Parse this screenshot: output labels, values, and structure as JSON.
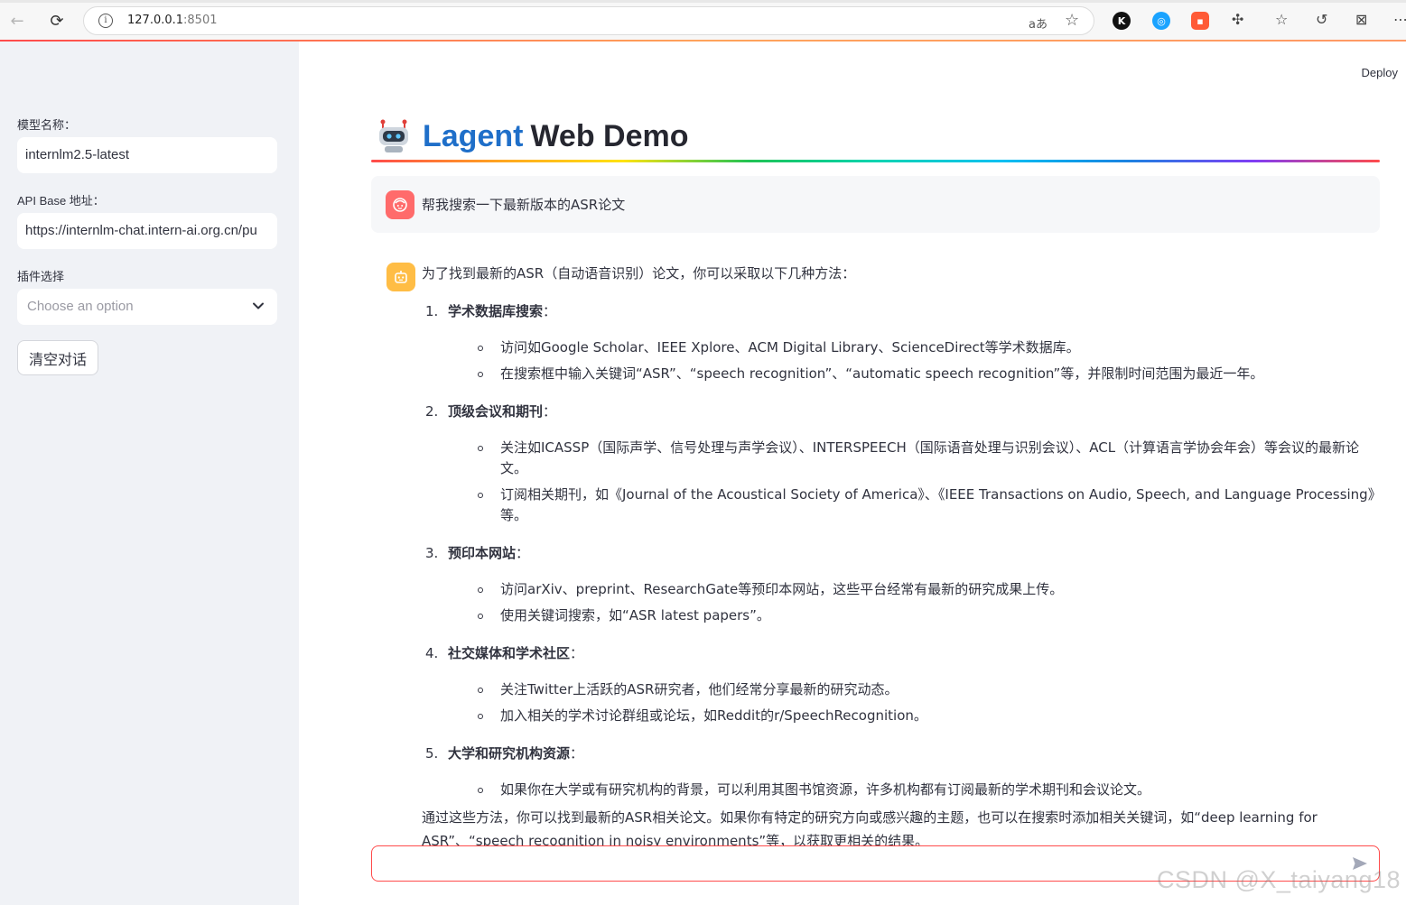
{
  "browser": {
    "url_host": "127.0.0.1",
    "url_port": ":8501"
  },
  "sidebar": {
    "model_label": "模型名称：",
    "model_value": "internlm2.5-latest",
    "api_label": "API Base 地址：",
    "api_value": "https://internlm-chat.intern-ai.org.cn/pu",
    "plugin_label": "插件选择",
    "plugin_placeholder": "Choose an option",
    "clear_button": "清空对话"
  },
  "header": {
    "deploy": "Deploy",
    "title_blue": "Lagent",
    "title_dark": "Web Demo"
  },
  "chat": {
    "user_message": "帮我搜索一下最新版本的ASR论文",
    "assistant": {
      "intro": "为了找到最新的ASR（自动语音识别）论文，你可以采取以下几种方法：",
      "items": [
        {
          "num": "1.",
          "title": "学术数据库搜索",
          "colon": "：",
          "bullets": [
            "访问如Google Scholar、IEEE Xplore、ACM Digital Library、ScienceDirect等学术数据库。",
            "在搜索框中输入关键词“ASR”、“speech recognition”、“automatic speech recognition”等，并限制时间范围为最近一年。"
          ]
        },
        {
          "num": "2.",
          "title": "顶级会议和期刊",
          "colon": "：",
          "bullets": [
            "关注如ICASSP（国际声学、信号处理与声学会议）、INTERSPEECH（国际语音处理与识别会议）、ACL（计算语言学协会年会）等会议的最新论文。",
            "订阅相关期刊，如《Journal of the Acoustical Society of America》、《IEEE Transactions on Audio, Speech, and Language Processing》等。"
          ]
        },
        {
          "num": "3.",
          "title": "预印本网站",
          "colon": "：",
          "bullets": [
            "访问arXiv、preprint、ResearchGate等预印本网站，这些平台经常有最新的研究成果上传。",
            "使用关键词搜索，如“ASR latest papers”。"
          ]
        },
        {
          "num": "4.",
          "title": "社交媒体和学术社区",
          "colon": "：",
          "bullets": [
            "关注Twitter上活跃的ASR研究者，他们经常分享最新的研究动态。",
            "加入相关的学术讨论群组或论坛，如Reddit的r/SpeechRecognition。"
          ]
        },
        {
          "num": "5.",
          "title": "大学和研究机构资源",
          "colon": "：",
          "bullets": [
            "如果你在大学或有研究机构的背景，可以利用其图书馆资源，许多机构都有订阅最新的学术期刊和会议论文。"
          ]
        }
      ],
      "conclusion": "通过这些方法，你可以找到最新的ASR相关论文。如果你有特定的研究方向或感兴趣的主题，也可以在搜索时添加相关关键词，如“deep learning for ASR”、“speech recognition in noisy environments”等，以获取更相关的结果。"
    },
    "input_value": ""
  },
  "watermark": "CSDN @X_taiyang18",
  "colors": {
    "accent": "#ff4b4b",
    "title_blue": "#1f6fc9",
    "sidebar_bg": "#f0f2f6",
    "user_avatar": "#ff6b6b",
    "bot_avatar": "#ffbd45"
  },
  "icons": [
    "back-icon",
    "reload-icon",
    "info-icon",
    "translate-icon",
    "star-icon",
    "extension-icon",
    "favorites-icon",
    "history-icon",
    "screenshot-icon",
    "more-icon",
    "robot-icon",
    "user-avatar-icon",
    "bot-avatar-icon",
    "chevron-down-icon",
    "send-icon"
  ]
}
